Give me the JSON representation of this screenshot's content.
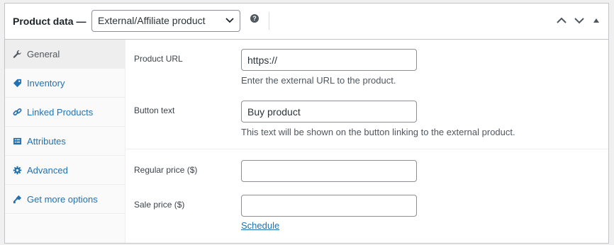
{
  "header": {
    "title": "Product data —",
    "product_type": "External/Affiliate product",
    "help_glyph": "?",
    "icons": [
      "chevron-down-icon",
      "help-icon",
      "move-up-icon",
      "move-down-icon",
      "toggle-panel-icon"
    ]
  },
  "sidebar": {
    "items": [
      {
        "label": "General",
        "icon": "wrench-icon",
        "active": true
      },
      {
        "label": "Inventory",
        "icon": "tag-icon",
        "active": false
      },
      {
        "label": "Linked Products",
        "icon": "link-icon",
        "active": false
      },
      {
        "label": "Attributes",
        "icon": "list-icon",
        "active": false
      },
      {
        "label": "Advanced",
        "icon": "gear-icon",
        "active": false
      },
      {
        "label": "Get more options",
        "icon": "plugin-icon",
        "active": false
      }
    ]
  },
  "general": {
    "product_url_label": "Product URL",
    "product_url_value": "https://",
    "product_url_desc": "Enter the external URL to the product.",
    "button_text_label": "Button text",
    "button_text_value": "Buy product",
    "button_text_desc": "This text will be shown on the button linking to the external product.",
    "regular_price_label": "Regular price ($)",
    "regular_price_value": "",
    "sale_price_label": "Sale price ($)",
    "sale_price_value": "",
    "schedule_link": "Schedule"
  },
  "colors": {
    "accent": "#2271b1",
    "border": "#c3c4c7",
    "sidebar_bg": "#fafafa",
    "active_tab_bg": "#eeeeee"
  }
}
